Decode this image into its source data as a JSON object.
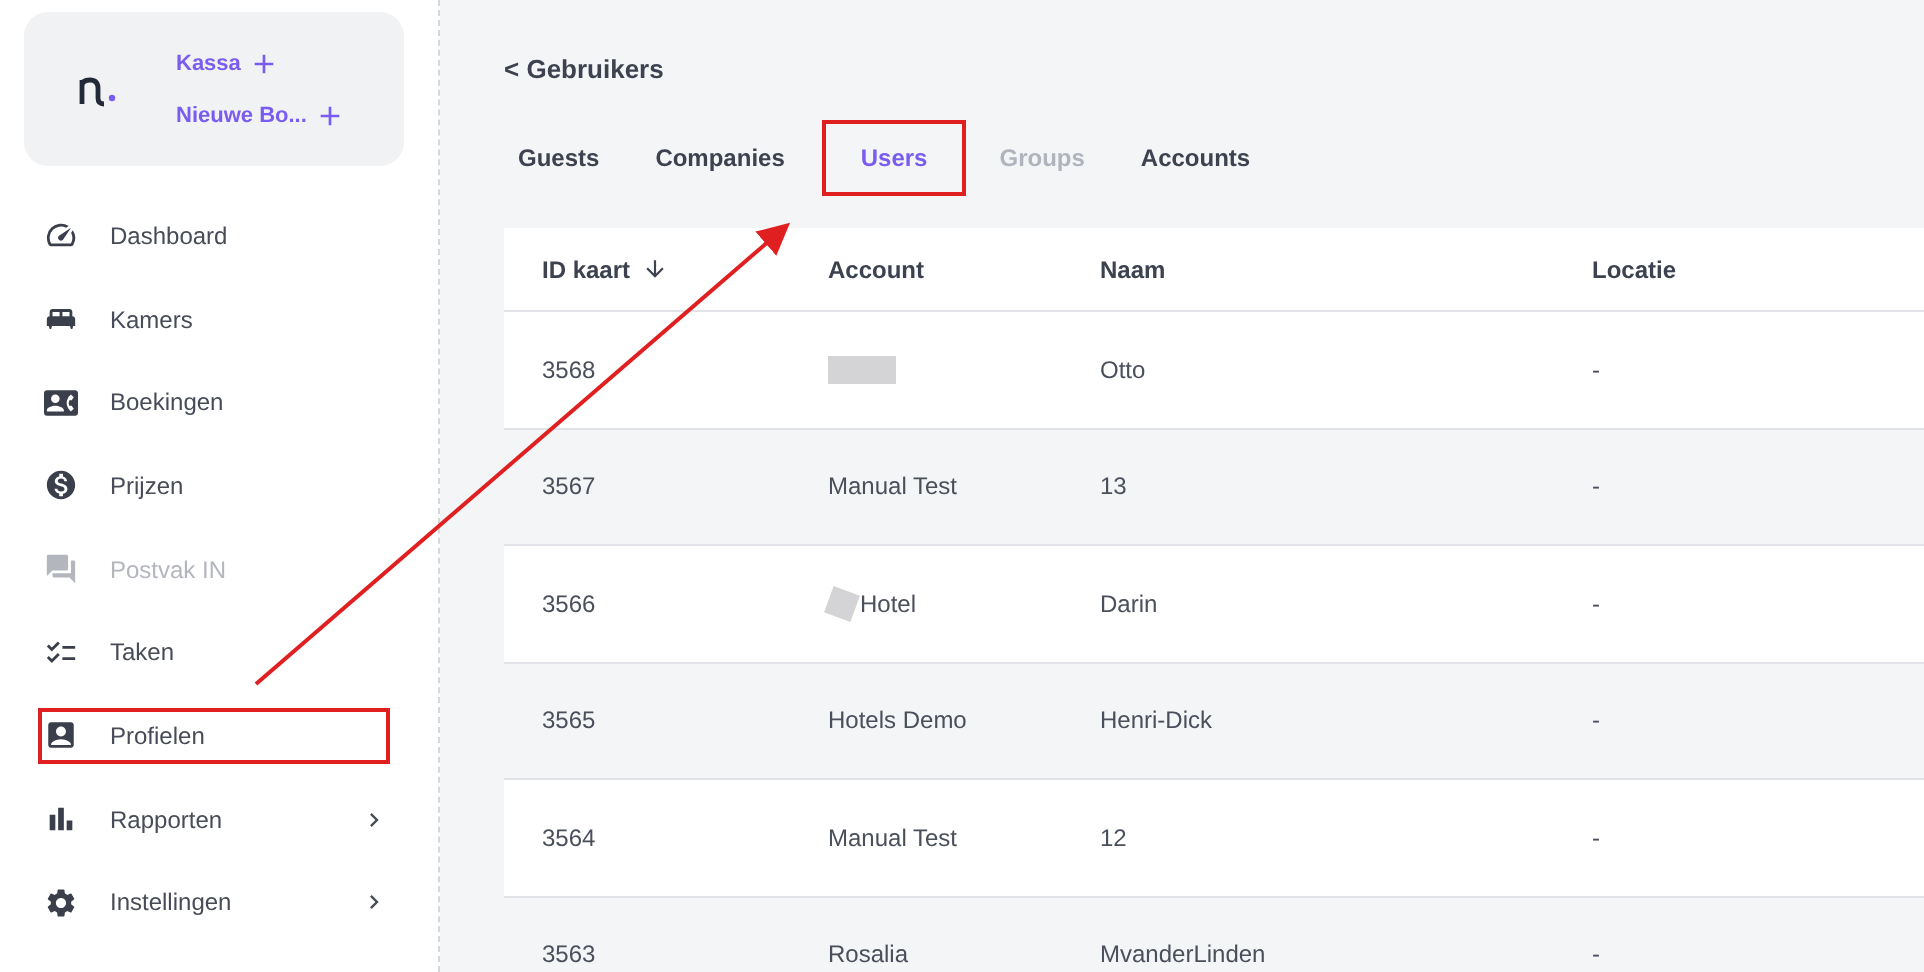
{
  "brand": {
    "actions": [
      {
        "label": "Kassa"
      },
      {
        "label": "Nieuwe Bo..."
      }
    ]
  },
  "sidebar": {
    "items": [
      {
        "label": "Dashboard",
        "disabled": false,
        "highlighted": false,
        "expandable": false
      },
      {
        "label": "Kamers",
        "disabled": false,
        "highlighted": false,
        "expandable": false
      },
      {
        "label": "Boekingen",
        "disabled": false,
        "highlighted": false,
        "expandable": false
      },
      {
        "label": "Prijzen",
        "disabled": false,
        "highlighted": false,
        "expandable": false
      },
      {
        "label": "Postvak IN",
        "disabled": true,
        "highlighted": false,
        "expandable": false
      },
      {
        "label": "Taken",
        "disabled": false,
        "highlighted": false,
        "expandable": false
      },
      {
        "label": "Profielen",
        "disabled": false,
        "highlighted": true,
        "expandable": false
      },
      {
        "label": "Rapporten",
        "disabled": false,
        "highlighted": false,
        "expandable": true
      },
      {
        "label": "Instellingen",
        "disabled": false,
        "highlighted": false,
        "expandable": true
      }
    ]
  },
  "back_link": "< Gebruikers",
  "tabs": [
    {
      "label": "Guests",
      "selected": false,
      "disabled": false,
      "highlighted": false
    },
    {
      "label": "Companies",
      "selected": false,
      "disabled": false,
      "highlighted": false
    },
    {
      "label": "Users",
      "selected": true,
      "disabled": false,
      "highlighted": true
    },
    {
      "label": "Groups",
      "selected": false,
      "disabled": true,
      "highlighted": false
    },
    {
      "label": "Accounts",
      "selected": false,
      "disabled": false,
      "highlighted": false
    }
  ],
  "table": {
    "columns": [
      {
        "label": "ID kaart",
        "sorted": true
      },
      {
        "label": "Account",
        "sorted": false
      },
      {
        "label": "Naam",
        "sorted": false
      },
      {
        "label": "Locatie",
        "sorted": false
      }
    ],
    "rows": [
      {
        "id": "3568",
        "account_redacted": true,
        "name": "Otto",
        "location": "-"
      },
      {
        "id": "3567",
        "account": "Manual Test",
        "account_redacted": false,
        "name": "13",
        "location": "-"
      },
      {
        "id": "3566",
        "account": "Hotel",
        "account_redacted": true,
        "name": "Darin",
        "location": "-"
      },
      {
        "id": "3565",
        "account": "Hotels Demo",
        "account_redacted": false,
        "name": "Henri-Dick",
        "location": "-"
      },
      {
        "id": "3564",
        "account": "Manual Test",
        "account_redacted": false,
        "name": "12",
        "location": "-"
      },
      {
        "id": "3563",
        "account": "Rosalia",
        "account_redacted": false,
        "name": "MvanderLinden",
        "location": "-"
      }
    ]
  },
  "annotation": {
    "arrow": true
  }
}
